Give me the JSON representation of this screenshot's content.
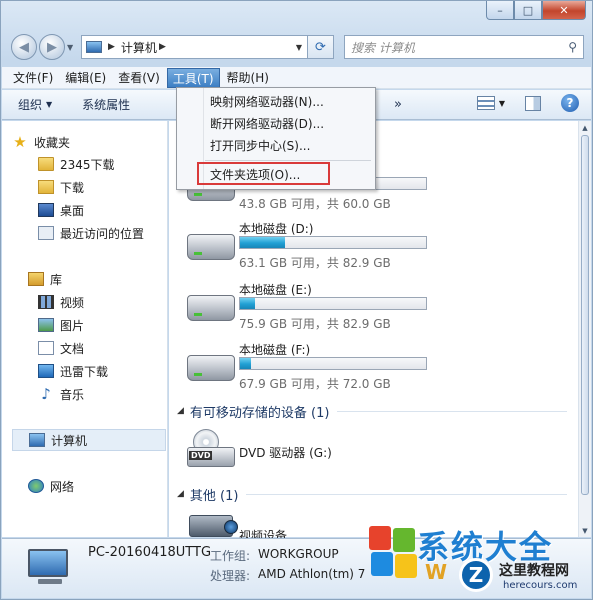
{
  "window": {
    "controls": {
      "minimize": "–",
      "maximize": "□",
      "close": "✕"
    }
  },
  "address": {
    "breadcrumb": "计算机",
    "search_placeholder": "搜索 计算机"
  },
  "menubar": [
    {
      "label": "文件(F)"
    },
    {
      "label": "编辑(E)"
    },
    {
      "label": "查看(V)"
    },
    {
      "label": "工具(T)",
      "active": true
    },
    {
      "label": "帮助(H)"
    }
  ],
  "toolbar": {
    "organize": "组织",
    "system_properties": "系统属性",
    "more": "»"
  },
  "tools_menu": {
    "items": [
      {
        "label": "映射网络驱动器(N)..."
      },
      {
        "label": "断开网络驱动器(D)..."
      },
      {
        "label": "打开同步中心(S)..."
      },
      {
        "label": "文件夹选项(O)...",
        "highlighted": true
      }
    ]
  },
  "nav": {
    "favorites": "收藏夹",
    "fav_items": [
      "2345下载",
      "下载",
      "桌面",
      "最近访问的位置"
    ],
    "libraries": "库",
    "lib_items": [
      "视频",
      "图片",
      "文档",
      "迅雷下载",
      "音乐"
    ],
    "computer": "计算机",
    "network": "网络"
  },
  "drives": [
    {
      "name": "",
      "free_text": "43.8 GB 可用，共 60.0 GB",
      "used_fraction": 0.27
    },
    {
      "name": "本地磁盘 (D:)",
      "free_text": "63.1 GB 可用，共 82.9 GB",
      "used_fraction": 0.24
    },
    {
      "name": "本地磁盘 (E:)",
      "free_text": "75.9 GB 可用，共 82.9 GB",
      "used_fraction": 0.08
    },
    {
      "name": "本地磁盘 (F:)",
      "free_text": "67.9 GB 可用，共 72.0 GB",
      "used_fraction": 0.06
    }
  ],
  "groups": {
    "removable": "有可移动存储的设备 (1)",
    "other": "其他 (1)"
  },
  "devices": {
    "dvd": "DVD 驱动器 (G:)",
    "dvd_label": "DVD",
    "camera": "视频设备"
  },
  "details": {
    "pc_name": "PC-20160418UTTG",
    "workgroup_label": "工作组:",
    "workgroup": "WORKGROUP",
    "processor_label": "处理器:",
    "processor": "AMD Athlon(tm) 7"
  },
  "watermark": {
    "brand": "系统大全",
    "site": "这里教程网",
    "url": "herecours.com",
    "letter": "Z",
    "w": "W"
  }
}
